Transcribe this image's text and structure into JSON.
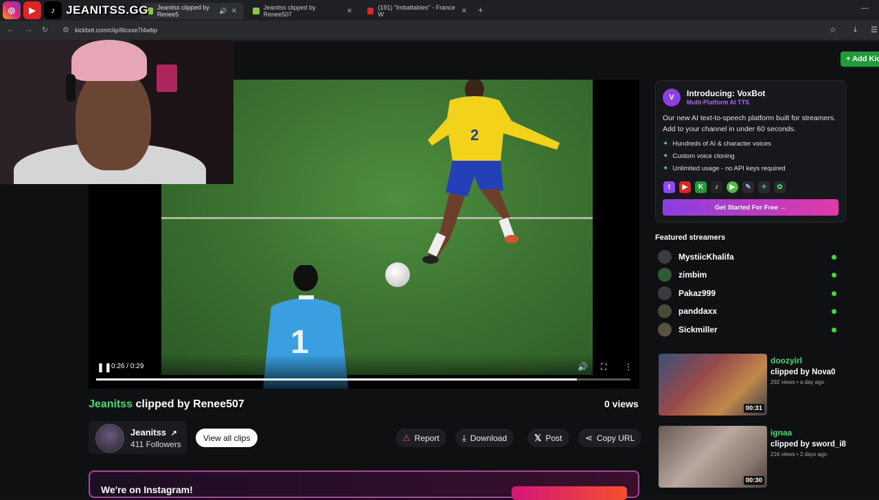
{
  "browser": {
    "tabs": [
      {
        "label": "Jeanitss clipped by Renee5",
        "active": true
      },
      {
        "label": "Jeanitss clipped by Renee507",
        "active": false
      },
      {
        "label": "(191) \"Imbattables\" - France W",
        "active": false
      }
    ],
    "url": "kickbot.com/clip/l6cxxe7l4wbp"
  },
  "overlay": {
    "brand": "JEANITSS.GG"
  },
  "header": {
    "add_button": "+ Add Kic"
  },
  "video": {
    "time": "0:26 / 0:29",
    "progress": 0.9,
    "jersey_front": "2",
    "jersey_keeper": "1"
  },
  "clip": {
    "streamer": "Jeanitss",
    "clipped_by": "clipped by Renee507",
    "views": "0 views",
    "channel_name": "Jeanitss",
    "followers": "411 Followers",
    "view_all": "View all clips",
    "actions": [
      "Report",
      "Download",
      "Post",
      "Copy URL"
    ]
  },
  "instagram": {
    "text": "We're on Instagram!"
  },
  "promo": {
    "title": "Introducing: VoxBot",
    "subtitle": "Multi-Platform AI TTS",
    "description": "Our new AI text-to-speech platform built for streamers. Add to your channel in under 60 seconds.",
    "features": [
      "Hundreds of AI & character voices",
      "Custom voice cloning",
      "Unlimited usage - no API keys required"
    ],
    "cta": "Get Started For Free →"
  },
  "featured": {
    "heading": "Featured streamers",
    "streamers": [
      "MystiicKhalifa",
      "zimbim",
      "Pakaz999",
      "panddaxx",
      "Sickmiller"
    ]
  },
  "related": [
    {
      "user": "doozyirl",
      "by": "clipped by Nova0",
      "meta": "292 views • a day ago",
      "duration": "00:31"
    },
    {
      "user": "ignaa",
      "by": "clipped by sword_i8",
      "meta": "216 views • 2 days ago",
      "duration": "00:30"
    }
  ],
  "colors": {
    "accent_green": "#3ddc74",
    "promo_purple": "#8a3fe0",
    "promo_pink": "#e23aa8"
  }
}
